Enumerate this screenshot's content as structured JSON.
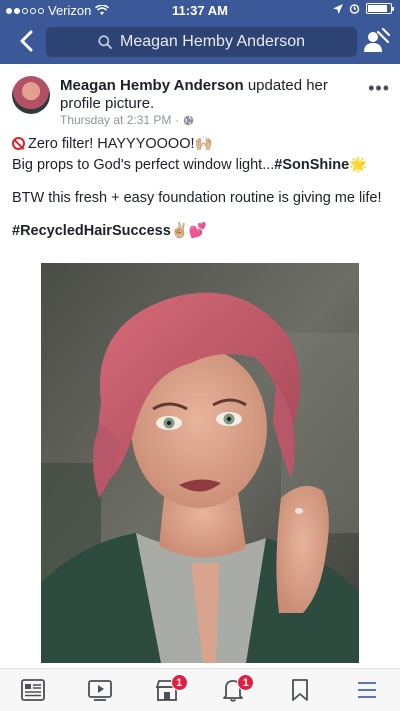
{
  "status_bar": {
    "carrier": "Verizon",
    "time": "11:37 AM"
  },
  "nav": {
    "search_text": "Meagan Hemby Anderson"
  },
  "post": {
    "author": "Meagan Hemby Anderson",
    "action": "updated her profile picture.",
    "timestamp": "Thursday at 2:31 PM",
    "privacy_icon": "globe-icon",
    "lines": {
      "line1_text": "Zero filter! HAYYYOOOO!",
      "line1_emoji": "🙌🏼",
      "line2_text": "Big props to God's perfect window light...",
      "line2_hashtag": "#SonShine",
      "line2_emoji": "🌟",
      "line3_text": "BTW this fresh + easy foundation routine is giving me life!",
      "line4_hashtag": "#RecycledHairSuccess",
      "line4_emoji": "✌🏼💕"
    }
  },
  "tabbar": {
    "tabs": [
      {
        "icon": "news-feed-icon"
      },
      {
        "icon": "video-icon"
      },
      {
        "icon": "marketplace-icon",
        "badge": "1"
      },
      {
        "icon": "notifications-bell-icon",
        "badge": "1"
      },
      {
        "icon": "bookmark-icon"
      },
      {
        "icon": "menu-icon"
      }
    ]
  },
  "colors": {
    "brand": "#3b5998",
    "search_bg": "#2d4373",
    "badge": "#e41e3f",
    "secondary_text": "#90949c",
    "tab_active": "#4267b2"
  }
}
